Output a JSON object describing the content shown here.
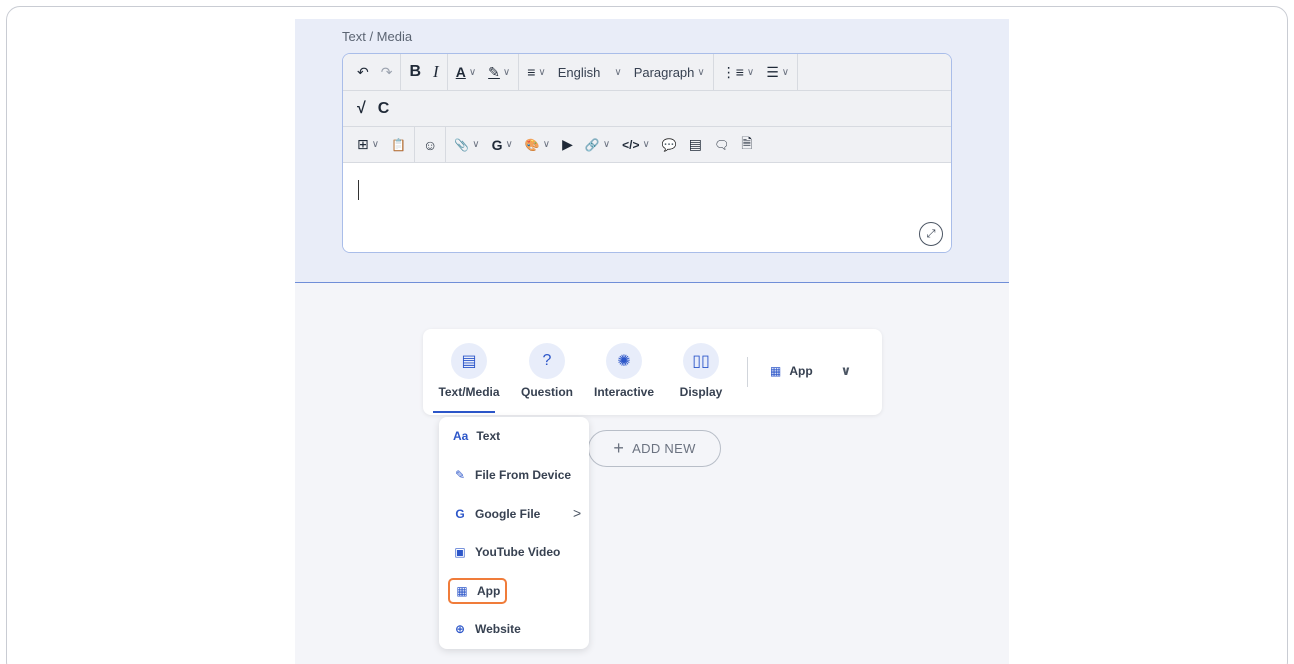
{
  "section": {
    "label": "Text / Media"
  },
  "toolbar": {
    "row1": {
      "undo": "↶",
      "redo": "↷",
      "bold": "B",
      "italic": "I",
      "font_color": "A",
      "highlight": "✎",
      "align": "≡",
      "language": "English",
      "block_format": "Paragraph",
      "ordered_list": "⋮≡",
      "bullet_list": "☰",
      "chevron": "∨"
    },
    "row2": {
      "math": "√",
      "chem": "C"
    },
    "row3": {
      "table": "⊞",
      "paste": "📋",
      "emoji": "☺",
      "attach": "📎",
      "google": "G",
      "palette": "🎨",
      "media": "▶",
      "link": "🔗",
      "code": "</>",
      "comment": "💬",
      "notes": "▤",
      "speech": "🗨",
      "file": "🗎"
    },
    "expand": "⤢"
  },
  "content_types": {
    "tabs": [
      {
        "label": "Text/Media",
        "icon": "text-media-icon",
        "glyph": "▤",
        "active": true
      },
      {
        "label": "Question",
        "icon": "question-icon",
        "glyph": "?",
        "active": false
      },
      {
        "label": "Interactive",
        "icon": "interactive-icon",
        "glyph": "✺",
        "active": false
      },
      {
        "label": "Display",
        "icon": "display-icon",
        "glyph": "▯▯",
        "active": false
      }
    ],
    "app_selector": {
      "label": "App",
      "glyph": "▦",
      "chevron": "∨"
    }
  },
  "add_new": {
    "label": "ADD NEW",
    "plus": "+"
  },
  "dropdown": {
    "items": [
      {
        "label": "Text",
        "icon": "text-aa-icon",
        "glyph": "Aa"
      },
      {
        "label": "File From Device",
        "icon": "paperclip-icon",
        "glyph": "✎"
      },
      {
        "label": "Google File",
        "icon": "google-icon",
        "glyph": "G",
        "arrow": ">"
      },
      {
        "label": "YouTube Video",
        "icon": "video-icon",
        "glyph": "▣"
      },
      {
        "label": "App",
        "icon": "app-icon",
        "glyph": "▦",
        "highlighted": true
      },
      {
        "label": "Website",
        "icon": "globe-icon",
        "glyph": "⊕"
      }
    ]
  },
  "colors": {
    "accent": "#2c56c9",
    "highlight": "#f07c3a",
    "editor_border": "#a9bde9"
  }
}
